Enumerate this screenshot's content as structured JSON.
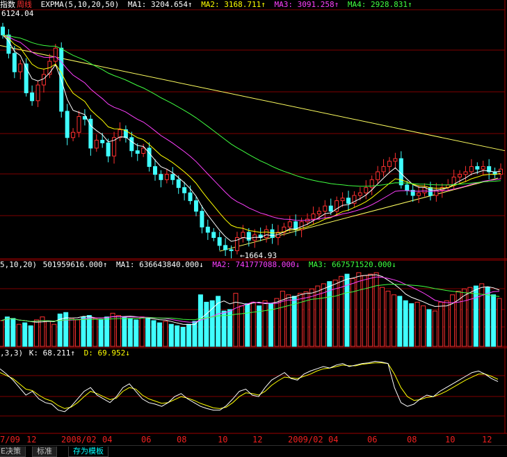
{
  "header": {
    "index_label": "指数",
    "period_label": "周线",
    "indicator_label": "EXPMA(5,10,20,50)",
    "ma_values": [
      {
        "label": "MA1: 3204.654↑",
        "color": "#ffffff"
      },
      {
        "label": "MA2: 3168.711↑",
        "color": "#ffff00"
      },
      {
        "label": "MA3: 3091.258↑",
        "color": "#ff40ff"
      },
      {
        "label": "MA4: 2928.831↑",
        "color": "#40ff40"
      }
    ]
  },
  "price_panel": {
    "top_value_label": "6124.04",
    "low_marker_label": "1664.93"
  },
  "volume_header": {
    "params": "5,10,20)",
    "value": "501959616.000↑",
    "ma_values": [
      {
        "label": "MA1: 636643840.000↓",
        "color": "#ffffff"
      },
      {
        "label": "MA2: 741777088.000↓",
        "color": "#ff40ff"
      },
      {
        "label": "MA3: 667571520.000↓",
        "color": "#40ff40"
      }
    ]
  },
  "kdj_header": {
    "params": ",3,3)",
    "k_label": "K: 68.211↑",
    "d_label": "D: 69.952↓"
  },
  "x_axis_labels": [
    "7/09",
    "12",
    "2008/02",
    "04",
    "06",
    "08",
    "10",
    "12",
    "2009/02",
    "04",
    "06",
    "08",
    "10",
    "12"
  ],
  "tabs": [
    {
      "label": "E决策",
      "active": false
    },
    {
      "label": "标准",
      "active": false
    },
    {
      "label": "存为模板",
      "active": true
    }
  ],
  "colors": {
    "up_candle": "#ff3030",
    "down_candle": "#40ffff",
    "grid": "#800000",
    "ema5": "#ffffff",
    "ema10": "#ffff00",
    "ema20": "#ff40ff",
    "ema50": "#40ff40",
    "trendline": "#ffff60"
  },
  "chart_data": {
    "type": "candlestick",
    "price_closes": [
      5800,
      5450,
      5100,
      5250,
      4700,
      4550,
      4850,
      5050,
      5300,
      5550,
      4350,
      3850,
      3950,
      4250,
      4200,
      3650,
      3800,
      3750,
      3500,
      3850,
      4000,
      3850,
      3600,
      3550,
      3650,
      3300,
      3150,
      3050,
      3150,
      3050,
      2900,
      2800,
      2650,
      2450,
      2150,
      2050,
      1950,
      1800,
      1720,
      1700,
      1950,
      2050,
      1900,
      2000,
      1950,
      2100,
      1950,
      2050,
      2150,
      2250,
      2100,
      2250,
      2300,
      2400,
      2450,
      2550,
      2450,
      2650,
      2700,
      2600,
      2750,
      2800,
      2900,
      3050,
      3200,
      3300,
      3400,
      3450,
      2950,
      2850,
      2750,
      2800,
      2900,
      2750,
      2850,
      2900,
      2950,
      3100,
      3150,
      3200,
      3300,
      3250,
      3300,
      3200,
      3150,
      3250
    ],
    "volume": [
      35,
      40,
      38,
      30,
      32,
      28,
      36,
      40,
      34,
      30,
      44,
      46,
      38,
      36,
      40,
      42,
      38,
      36,
      40,
      45,
      42,
      40,
      38,
      36,
      40,
      38,
      35,
      32,
      34,
      30,
      28,
      26,
      30,
      34,
      70,
      60,
      62,
      68,
      48,
      50,
      72,
      55,
      58,
      60,
      55,
      62,
      58,
      65,
      75,
      70,
      68,
      72,
      74,
      78,
      82,
      85,
      88,
      90,
      95,
      98,
      92,
      100,
      96,
      98,
      100,
      80,
      75,
      70,
      68,
      62,
      58,
      60,
      55,
      50,
      48,
      60,
      62,
      70,
      75,
      78,
      80,
      82,
      85,
      80,
      70,
      65
    ],
    "kdj_k": [
      85,
      78,
      70,
      60,
      50,
      55,
      45,
      40,
      38,
      30,
      28,
      35,
      45,
      55,
      60,
      50,
      45,
      40,
      48,
      60,
      65,
      55,
      45,
      40,
      38,
      35,
      40,
      48,
      52,
      45,
      40,
      35,
      32,
      30,
      30,
      36,
      45,
      55,
      58,
      50,
      48,
      60,
      70,
      75,
      80,
      72,
      70,
      78,
      82,
      85,
      88,
      86,
      90,
      92,
      88,
      90,
      92,
      93,
      95,
      94,
      92,
      60,
      40,
      35,
      38,
      45,
      50,
      48,
      55,
      60,
      65,
      70,
      75,
      80,
      82,
      78,
      72,
      68
    ],
    "kdj_d": [
      80,
      76,
      72,
      65,
      58,
      56,
      50,
      45,
      42,
      36,
      32,
      34,
      40,
      48,
      55,
      52,
      48,
      44,
      46,
      55,
      60,
      58,
      50,
      45,
      42,
      39,
      40,
      44,
      48,
      46,
      43,
      39,
      36,
      33,
      32,
      34,
      40,
      48,
      53,
      52,
      50,
      55,
      63,
      69,
      74,
      73,
      72,
      75,
      78,
      82,
      85,
      86,
      88,
      90,
      89,
      89,
      91,
      92,
      93,
      93,
      92,
      78,
      60,
      48,
      43,
      44,
      47,
      48,
      51,
      55,
      60,
      65,
      70,
      74,
      78,
      78,
      75,
      71
    ],
    "trendline_top": [
      5600,
      3600
    ],
    "support_line": [
      1690,
      3080
    ]
  }
}
